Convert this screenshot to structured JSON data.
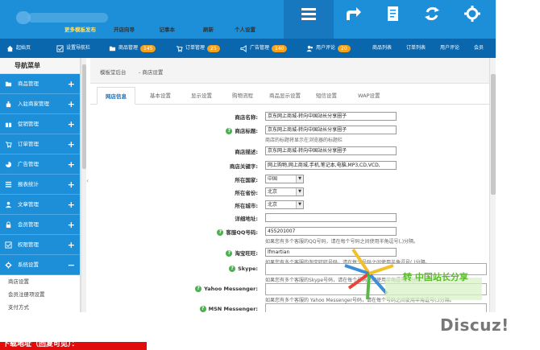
{
  "header": {
    "buttons": [
      {
        "label": "更多模板发布",
        "icon": "menu-icon",
        "highlight": true
      },
      {
        "label": "开店向导",
        "icon": "share-arrow-icon"
      },
      {
        "label": "记事本",
        "icon": "notebook-icon"
      },
      {
        "label": "刷新",
        "icon": "refresh-icon"
      },
      {
        "label": "个人设置",
        "icon": "gear-icon"
      }
    ]
  },
  "navbar": {
    "items": [
      {
        "label": "起始页"
      },
      {
        "label": "设置导航栏"
      },
      {
        "label": "商品管理",
        "badge": "145"
      },
      {
        "label": "订单管理",
        "badge": "25"
      },
      {
        "label": "广告管理",
        "badge": "140"
      },
      {
        "label": "用户评论",
        "badge": "20"
      },
      {
        "label": "商品列表"
      },
      {
        "label": "订单列表"
      },
      {
        "label": "用户评论"
      },
      {
        "label": "会员"
      }
    ]
  },
  "sidebar": {
    "title": "导航菜单",
    "items": [
      {
        "label": "商品管理",
        "icon": "folder-icon",
        "toggle": "+"
      },
      {
        "label": "入驻商家管理",
        "icon": "hand-icon",
        "toggle": "+"
      },
      {
        "label": "促销管理",
        "icon": "gift-icon",
        "toggle": "+"
      },
      {
        "label": "订单管理",
        "icon": "cart-icon",
        "toggle": "+"
      },
      {
        "label": "广告管理",
        "icon": "pie-icon",
        "toggle": "+"
      },
      {
        "label": "报表统计",
        "icon": "list-icon",
        "toggle": "+"
      },
      {
        "label": "文章管理",
        "icon": "user-icon",
        "toggle": "+"
      },
      {
        "label": "会员管理",
        "icon": "lock-icon",
        "toggle": "+"
      },
      {
        "label": "权限管理",
        "icon": "check-icon",
        "toggle": "+"
      },
      {
        "label": "系统设置",
        "icon": "gear-icon",
        "toggle": "−"
      }
    ],
    "sub_items": [
      "商店设置",
      "会员注册项设置",
      "支付方式"
    ]
  },
  "breadcrumb": {
    "home": "模板堂后台",
    "current": "- 商店设置"
  },
  "tabs": [
    "网店信息",
    "基本设置",
    "显示设置",
    "购物流程",
    "商品显示设置",
    "短信设置",
    "WAP设置"
  ],
  "form": {
    "shop_name": {
      "label": "商店名称:",
      "value": "京东网上商城-转向中国站长分享圈子"
    },
    "shop_title": {
      "label": "商店标题:",
      "value": "京东网上商城-转向中国站长分享圈子",
      "hint": "商店的标题将显示在浏览器的标题栏"
    },
    "shop_desc": {
      "label": "商店描述:",
      "value": "京东网上商城-转向中国站长分享圈子"
    },
    "shop_keywords": {
      "label": "商店关键字:",
      "value": "网上购物,网上商城,手机,笔记本,电脑,MP3,CD,VCD,"
    },
    "country": {
      "label": "所在国家:",
      "value": "中国"
    },
    "province": {
      "label": "所在省份:",
      "value": "北京"
    },
    "city": {
      "label": "所在城市:",
      "value": "北京"
    },
    "address": {
      "label": "详细地址:",
      "value": ""
    },
    "qq": {
      "label": "客服QQ号码:",
      "value": "455201007",
      "hint": "如果您有多个客服的QQ号码，请在每个号码之间使用半角逗号(,)分隔。"
    },
    "wangwang": {
      "label": "淘宝旺旺:",
      "value": "lfmartian",
      "hint": "如果您有多个客服的淘宝旺旺号码，请在每个号码之间使用半角逗号(,)分隔。"
    },
    "skype": {
      "label": "Skype:",
      "value": "",
      "hint": "如果您有多个客服的Skype号码，请在每个号码之间使用半角逗号(,)分隔。"
    },
    "yahoo": {
      "label": "Yahoo Messenger:",
      "value": "",
      "hint": "如果您有多个客服的 Yahoo Messenger号码，请在每个号码之间使用半角逗号(,)分隔。"
    },
    "msn": {
      "label": "MSN Messenger:",
      "value": ""
    }
  },
  "watermark": {
    "text": "Discuz!",
    "stamp": "转 中国站长分享"
  },
  "footer_banner": "下载地址（回复可见）："
}
